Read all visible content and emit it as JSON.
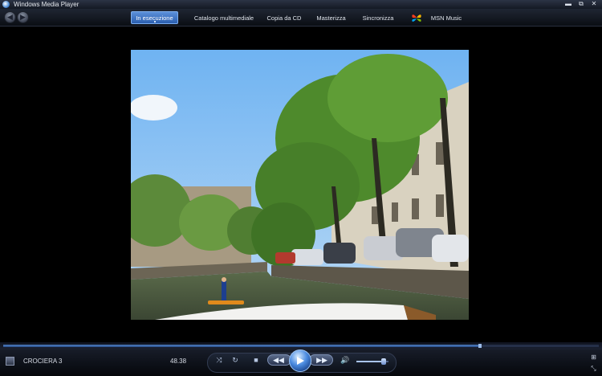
{
  "window": {
    "title": "Windows Media Player",
    "controls": {
      "minimize": "▬",
      "restore": "⧉",
      "close": "✕"
    }
  },
  "nav": {
    "back_icon": "back-arrow-icon",
    "forward_icon": "forward-arrow-icon",
    "tabs": [
      {
        "label": "In esecuzione",
        "active": true
      },
      {
        "label": "Catalogo multimediale",
        "active": false
      },
      {
        "label": "Copia da CD",
        "active": false
      },
      {
        "label": "Masterizza",
        "active": false
      },
      {
        "label": "Sincronizza",
        "active": false
      },
      {
        "label": "MSN Music",
        "active": false
      }
    ]
  },
  "now_playing": {
    "title": "CROCIERA 3",
    "elapsed": "48.38",
    "progress": 0.8
  },
  "volume": {
    "level": 0.85
  },
  "colors": {
    "accent": "#3a78d6",
    "background": "#000000",
    "bar_dark": "#0b0e14"
  }
}
